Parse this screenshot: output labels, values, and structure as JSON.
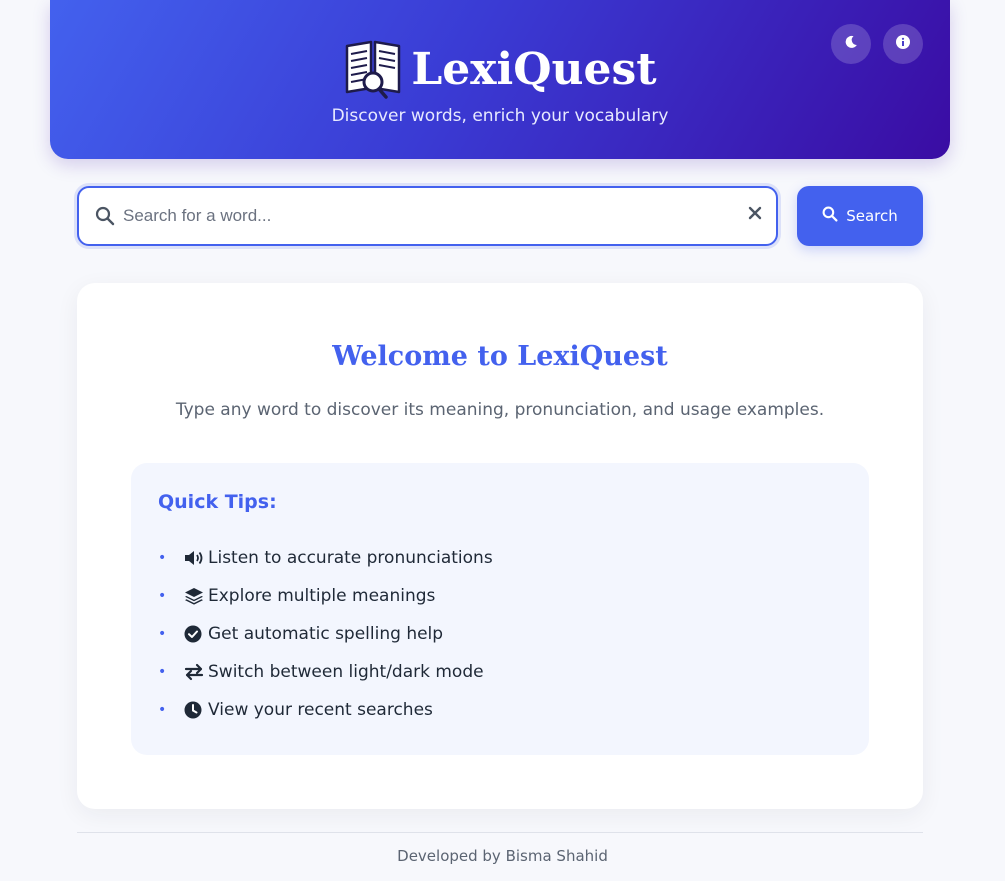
{
  "header": {
    "title": "LexiQuest",
    "tagline": "Discover words, enrich your vocabulary",
    "theme_toggle_icon": "moon-icon",
    "info_icon": "info-icon"
  },
  "search": {
    "placeholder": "Search for a word...",
    "value": "",
    "button_label": "Search"
  },
  "welcome": {
    "title": "Welcome to LexiQuest",
    "subtitle": "Type any word to discover its meaning, pronunciation, and usage examples."
  },
  "tips": {
    "title": "Quick Tips:",
    "items": [
      {
        "icon": "volume-icon",
        "label": "Listen to accurate pronunciations"
      },
      {
        "icon": "layers-icon",
        "label": "Explore multiple meanings"
      },
      {
        "icon": "check-circle-icon",
        "label": "Get automatic spelling help"
      },
      {
        "icon": "exchange-icon",
        "label": "Switch between light/dark mode"
      },
      {
        "icon": "clock-icon",
        "label": "View your recent searches"
      }
    ]
  },
  "footer": {
    "text": "Developed by Bisma Shahid"
  },
  "colors": {
    "accent": "#4361ee",
    "header_gradient_end": "#3a0ca3",
    "page_background": "#f7f8fc",
    "tips_background": "#f3f6fe"
  }
}
